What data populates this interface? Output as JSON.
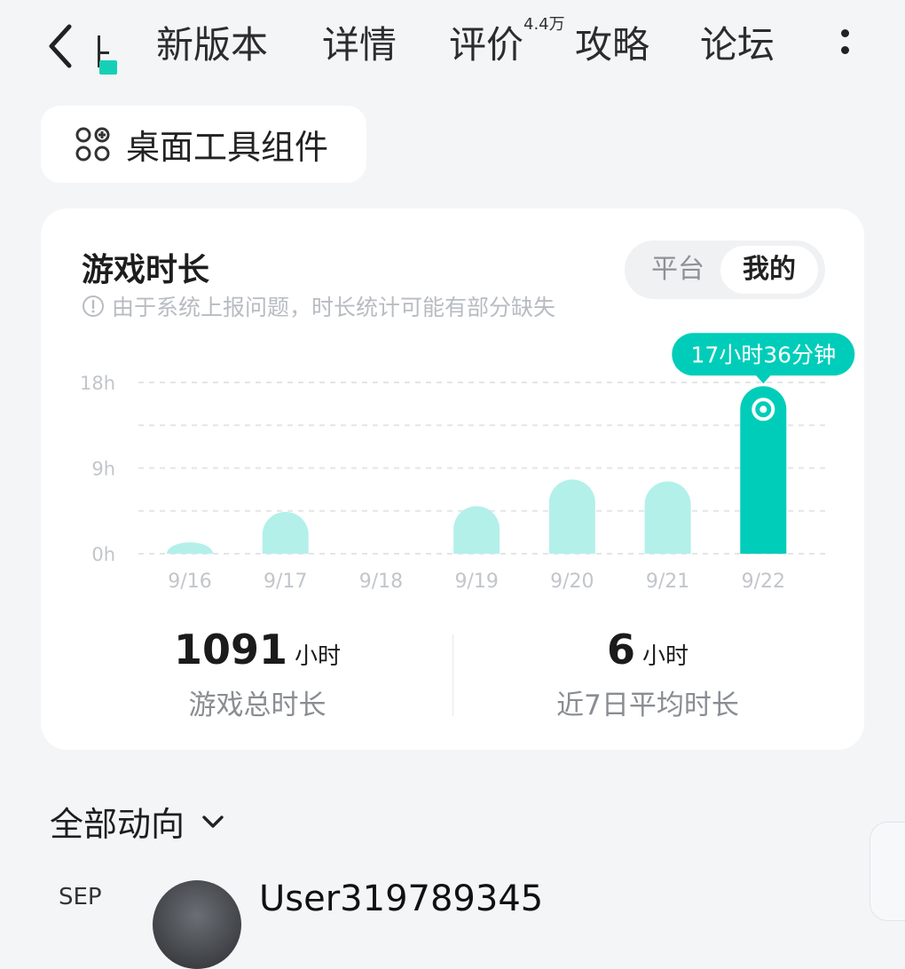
{
  "nav": {
    "tabs": [
      "新版本",
      "详情",
      "评价",
      "攻略",
      "论坛"
    ],
    "review_badge": "4.4万"
  },
  "widget_button": {
    "label": "桌面工具组件"
  },
  "playtime_card": {
    "title": "游戏时长",
    "note": "由于系统上报问题，时长统计可能有部分缺失",
    "toggle": {
      "platform": "平台",
      "mine": "我的"
    },
    "tooltip": "17小时36分钟",
    "stats": {
      "total_value": "1091",
      "total_unit": "小时",
      "total_label": "游戏总时长",
      "avg_value": "6",
      "avg_unit": "小时",
      "avg_label": "近7日平均时长"
    }
  },
  "chart_data": {
    "type": "bar",
    "categories": [
      "9/16",
      "9/17",
      "9/18",
      "9/19",
      "9/20",
      "9/21",
      "9/22"
    ],
    "values": [
      1.2,
      4.4,
      0,
      5.0,
      7.8,
      7.6,
      17.6
    ],
    "ylim": [
      0,
      18
    ],
    "yticks": [
      "0h",
      "9h",
      "18h"
    ],
    "grid": true,
    "highlight_index": 6,
    "colors": {
      "bar": "#b3f0ea",
      "highlight": "#00cdb9",
      "grid": "#e3e5e8",
      "axis_text": "#c2c5ca"
    }
  },
  "feed": {
    "filter_label": "全部动向",
    "date_partial": "SEP",
    "username_partial": "User319789345"
  }
}
